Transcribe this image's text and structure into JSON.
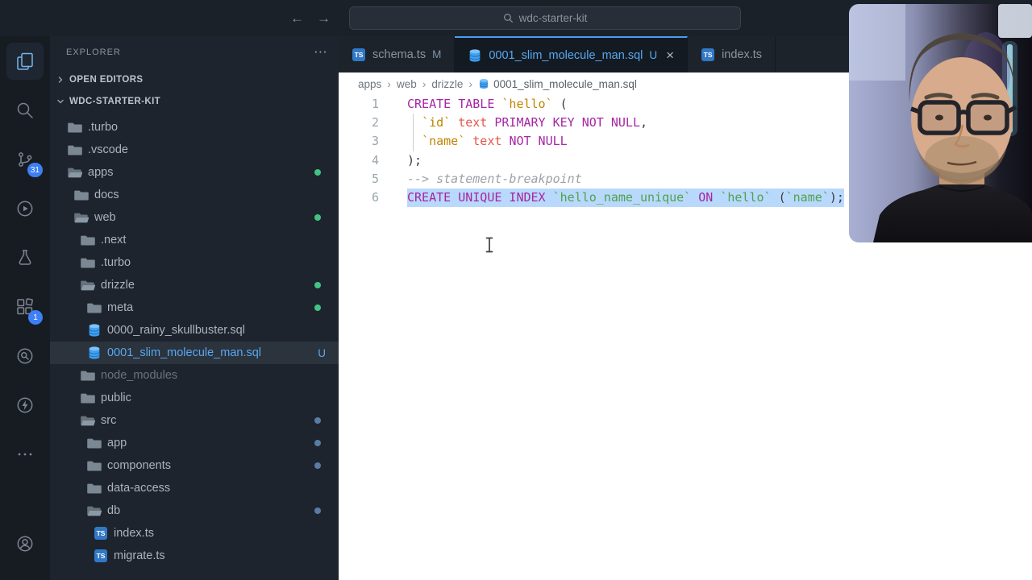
{
  "titlebar": {
    "search_value": "wdc-starter-kit"
  },
  "icons": {
    "back_arrow": "←",
    "forward_arrow": "→",
    "more_horizontal": "⋯",
    "close": "×",
    "breadcrumb_separator": "›",
    "ts_label": "TS"
  },
  "activity_bar": {
    "scm_badge": "31",
    "ext_badge": "1"
  },
  "sidebar": {
    "title": "EXPLORER",
    "sections": {
      "open_editors": "OPEN EDITORS",
      "project": "WDC-STARTER-KIT"
    },
    "tree": [
      {
        "label": ".turbo",
        "depth": 1,
        "icon": "folder"
      },
      {
        "label": ".vscode",
        "depth": 1,
        "icon": "folder"
      },
      {
        "label": "apps",
        "depth": 1,
        "icon": "folder-open",
        "badge": "dot-green"
      },
      {
        "label": "docs",
        "depth": 2,
        "icon": "folder"
      },
      {
        "label": "web",
        "depth": 2,
        "icon": "folder-open",
        "badge": "dot-green"
      },
      {
        "label": ".next",
        "depth": 3,
        "icon": "folder"
      },
      {
        "label": ".turbo",
        "depth": 3,
        "icon": "folder"
      },
      {
        "label": "drizzle",
        "depth": 3,
        "icon": "folder-open",
        "badge": "dot-green"
      },
      {
        "label": "meta",
        "depth": 4,
        "icon": "folder",
        "badge": "dot-green"
      },
      {
        "label": "0000_rainy_skullbuster.sql",
        "depth": 4,
        "icon": "database"
      },
      {
        "label": "0001_slim_molecule_man.sql",
        "depth": 4,
        "icon": "database",
        "badge": "U",
        "selected": true
      },
      {
        "label": "node_modules",
        "depth": 3,
        "icon": "folder",
        "dimmed": true
      },
      {
        "label": "public",
        "depth": 3,
        "icon": "folder"
      },
      {
        "label": "src",
        "depth": 3,
        "icon": "folder-open",
        "badge": "dot-blue"
      },
      {
        "label": "app",
        "depth": 4,
        "icon": "folder",
        "badge": "dot-blue"
      },
      {
        "label": "components",
        "depth": 4,
        "icon": "folder",
        "badge": "dot-blue"
      },
      {
        "label": "data-access",
        "depth": 4,
        "icon": "folder"
      },
      {
        "label": "db",
        "depth": 4,
        "icon": "folder-open",
        "badge": "dot-blue"
      },
      {
        "label": "index.ts",
        "depth": 5,
        "icon": "typescript"
      },
      {
        "label": "migrate.ts",
        "depth": 5,
        "icon": "typescript"
      }
    ]
  },
  "editor": {
    "tabs": [
      {
        "label": "schema.ts",
        "icon": "typescript",
        "badge": "M",
        "active": false
      },
      {
        "label": "0001_slim_molecule_man.sql",
        "icon": "database",
        "badge": "U",
        "active": true,
        "closable": true
      },
      {
        "label": "index.ts",
        "icon": "typescript",
        "badge": "",
        "active": false
      }
    ],
    "breadcrumbs": {
      "parts": [
        "apps",
        "web",
        "drizzle"
      ],
      "file": {
        "label": "0001_slim_molecule_man.sql",
        "icon": "database"
      }
    },
    "code": {
      "lines": [
        {
          "num": "1",
          "tokens": [
            [
              "CREATE TABLE",
              "kw"
            ],
            [
              " ",
              "plain"
            ],
            [
              "`hello`",
              "ent"
            ],
            [
              " (",
              "pun"
            ]
          ]
        },
        {
          "num": "2",
          "tokens": [
            [
              "  ",
              "plain"
            ],
            [
              "`id`",
              "ent"
            ],
            [
              " ",
              "plain"
            ],
            [
              "text",
              "typ"
            ],
            [
              " ",
              "plain"
            ],
            [
              "PRIMARY KEY NOT NULL",
              "kw"
            ],
            [
              ",",
              "pun"
            ]
          ]
        },
        {
          "num": "3",
          "tokens": [
            [
              "  ",
              "plain"
            ],
            [
              "`name`",
              "ent"
            ],
            [
              " ",
              "plain"
            ],
            [
              "text",
              "typ"
            ],
            [
              " ",
              "plain"
            ],
            [
              "NOT NULL",
              "kw"
            ]
          ]
        },
        {
          "num": "4",
          "tokens": [
            [
              ");",
              "pun"
            ]
          ]
        },
        {
          "num": "5",
          "tokens": [
            [
              "--> statement-breakpoint",
              "com"
            ]
          ]
        },
        {
          "num": "6",
          "selected": true,
          "tokens": [
            [
              "CREATE UNIQUE INDEX",
              "kw"
            ],
            [
              " ",
              "plain"
            ],
            [
              "`hello_name_unique`",
              "str"
            ],
            [
              " ",
              "plain"
            ],
            [
              "ON",
              "kw"
            ],
            [
              " ",
              "plain"
            ],
            [
              "`hello`",
              "str"
            ],
            [
              " (",
              "pun"
            ],
            [
              "`name`",
              "str"
            ],
            [
              ");",
              "pun"
            ]
          ]
        }
      ]
    }
  },
  "colors": {
    "accent_blue": "#4a9df0",
    "git_untracked": "#58a8f0",
    "git_modified": "#7e93a8",
    "dot_green": "#43c383",
    "dot_blue": "#5a7ba6",
    "badge_blue": "#3d7ff5",
    "selection": "#b9d9fc"
  }
}
